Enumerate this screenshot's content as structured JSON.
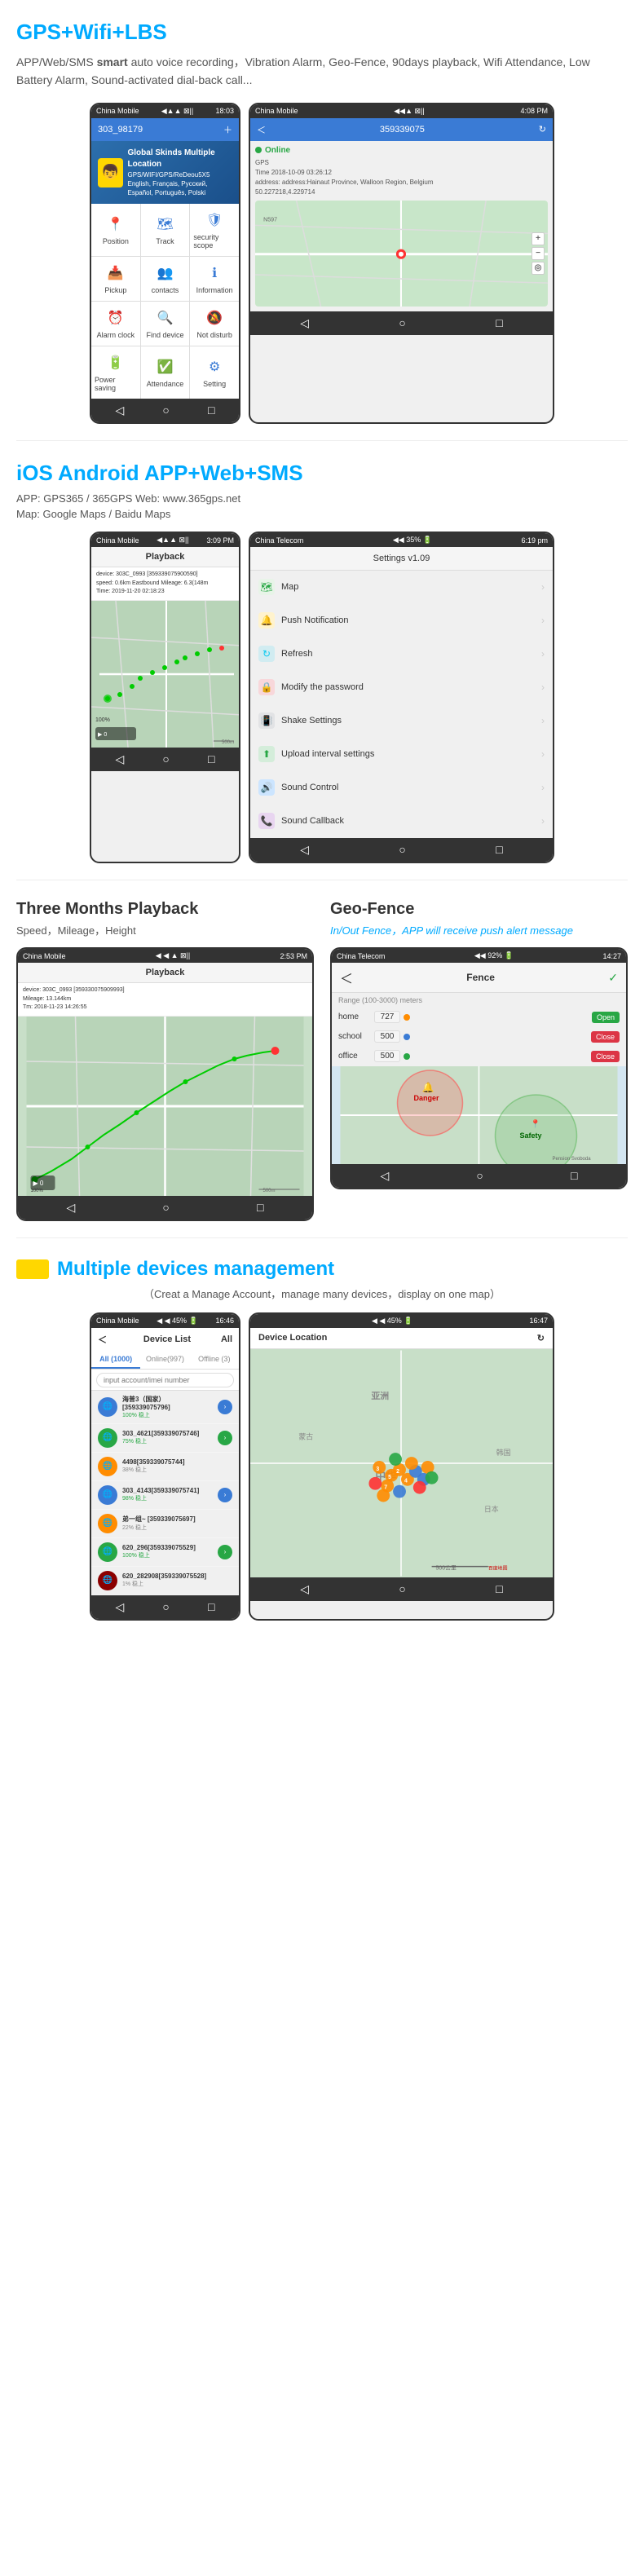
{
  "section1": {
    "title_plain": "GPS",
    "title_colored": "+Wifi+LBS",
    "description": "APP/Web/SMS smart auto voice recording，Vibration Alarm, Geo-Fence, 90days playback, Wifi Attendance, Low Battery Alarm, Sound-activated dial-back call...",
    "desc_bold": "smart",
    "left_phone": {
      "carrier": "China Mobile",
      "signal": "◀▲▲ Σ||",
      "time": "18:03",
      "account": "303_98179",
      "banner_title": "Global Skinds Multiple Location",
      "banner_sub": "GPS/WIFI/GPS/ReDeou5X5",
      "banner_langs": "English, Français, Pyccкий,",
      "banner_langs2": "Español, Português, Polski",
      "menu": [
        {
          "icon": "📍",
          "label": "Position",
          "color": "blue"
        },
        {
          "icon": "🗺",
          "label": "Track",
          "color": "blue"
        },
        {
          "icon": "🛡",
          "label": "security scope",
          "color": "blue"
        },
        {
          "icon": "📥",
          "label": "Pickup",
          "color": "orange"
        },
        {
          "icon": "👥",
          "label": "contacts",
          "color": "green"
        },
        {
          "icon": "ℹ",
          "label": "Information",
          "color": "blue"
        },
        {
          "icon": "⏰",
          "label": "Alarm clock",
          "color": "orange"
        },
        {
          "icon": "🔍",
          "label": "Find device",
          "color": "purple"
        },
        {
          "icon": "🔕",
          "label": "Not disturb",
          "color": "red"
        },
        {
          "icon": "🔋",
          "label": "Power saving",
          "color": "green"
        },
        {
          "icon": "✅",
          "label": "Attendance",
          "color": "blue"
        },
        {
          "icon": "⚙",
          "label": "Setting",
          "color": "blue"
        }
      ]
    },
    "right_phone": {
      "carrier": "China Mobile",
      "signal": "◀◀▲ Σ||",
      "time": "4:08 PM",
      "account": "359339075",
      "status": "Online",
      "gps_label": "GPS",
      "time_info": "Time 2018-10-09 03:26:12",
      "address_info": "address: address:Hainaut Province, Walloon Region, Belgium",
      "coords": "50.227218,4.229714"
    }
  },
  "section2": {
    "title_plain": "iOS Android APP",
    "title_colored": "+Web+SMS",
    "app_line": "APP:  GPS365 / 365GPS   Web:  www.365gps.net",
    "map_line": "Map:  Google Maps / Baidu Maps",
    "left_phone": {
      "carrier": "China Mobile",
      "signal": "◀▲▲ Σ||",
      "time": "3:09 PM",
      "title": "Playback",
      "info_line1": "device: 303C_0993 [359339075900590]",
      "info_line2": "speed: 0.6km Eastbound Mileage: 6.3(148m",
      "info_line3": "Time: 2019-11-20 02:18:23"
    },
    "right_phone": {
      "carrier": "China Telecom",
      "signal": "◀◀ 35% 🔋",
      "time": "6:19 pm",
      "title": "Settings v1.09",
      "items": [
        {
          "icon": "map",
          "label": "Map"
        },
        {
          "icon": "notif",
          "label": "Push Notification"
        },
        {
          "icon": "refresh",
          "label": "Refresh"
        },
        {
          "icon": "lock",
          "label": "Modify the password"
        },
        {
          "icon": "shake",
          "label": "Shake Settings"
        },
        {
          "icon": "upload",
          "label": "Upload interval settings"
        },
        {
          "icon": "sound",
          "label": "Sound Control"
        },
        {
          "icon": "callback",
          "label": "Sound Callback"
        }
      ]
    }
  },
  "section3": {
    "left": {
      "title": "Three Months Playback",
      "subtitle": "Speed，Mileage，Height",
      "phone": {
        "carrier": "China Mobile",
        "signal": "◀ ◀ ▲ Σ||",
        "time": "2:53 PM",
        "title": "Playback",
        "info_line1": "device: 303C_0993 [359330075909993]",
        "info_line2": "Mileage: 13.144km",
        "info_line3": "Tm: 2018-11-23 14:26:55"
      }
    },
    "right": {
      "title": "Geo-Fence",
      "subtitle": "In/Out Fence，APP will receive push alert message",
      "phone": {
        "carrier": "China Telecom",
        "signal": "◀◀ 92% 🔋",
        "time": "14:27",
        "title": "Fence",
        "range_label": "Range (100-3000) meters",
        "rows": [
          {
            "name": "home",
            "value": "727",
            "dot_color": "#ff8c00",
            "btn": "Open",
            "btn_class": "open"
          },
          {
            "name": "school",
            "value": "500",
            "dot_color": "#3a7bd5",
            "btn": "Close",
            "btn_class": "close"
          },
          {
            "name": "office",
            "value": "500",
            "dot_color": "#28a745",
            "btn": "Close",
            "btn_class": "close"
          }
        ],
        "danger_label": "Danger",
        "safety_label": "Safety"
      }
    }
  },
  "section4": {
    "title_plain": "Multiple devices management",
    "sub_text": "（Creat a Manage Account，manage many devices，display on one map）",
    "left_phone": {
      "carrier": "China Mobile",
      "signal": "◀ ◀ 45% 🔋",
      "time": "16:46",
      "title": "Device List",
      "right_label": "All",
      "tabs": [
        "All (1000)",
        "Online(997)",
        "Offline (3)"
      ],
      "active_tab": 0,
      "search_placeholder": "input account/imei number",
      "devices": [
        {
          "id": "海普3（国家）[359339075796]",
          "status": "100% 稳上",
          "has_btn": true,
          "btn_class": "blue",
          "avatar_class": ""
        },
        {
          "id": "303_4621[359339075746]",
          "status": "75% 稳上",
          "has_btn": true,
          "btn_class": "green",
          "avatar_class": "green"
        },
        {
          "id": "4498[359339075744]",
          "status": "38% 稳上",
          "has_btn": false,
          "btn_class": "",
          "avatar_class": "orange"
        },
        {
          "id": "303_4143[359339075741]",
          "status": "98% 稳上",
          "has_btn": true,
          "btn_class": "blue",
          "avatar_class": ""
        },
        {
          "id": "弟一组~ [359339075697]",
          "status": "22% 稳上",
          "has_btn": false,
          "btn_class": "",
          "avatar_class": "orange"
        },
        {
          "id": "620_296[359339075529]",
          "status": "100% 稳上",
          "has_btn": true,
          "btn_class": "green",
          "avatar_class": "green"
        },
        {
          "id": "620_282908[359339075528]",
          "status": "1% 稳上",
          "has_btn": false,
          "btn_class": "",
          "avatar_class": "red-dark"
        }
      ]
    },
    "right_phone": {
      "carrier": "",
      "signal": "◀ ◀ 45% 🔋",
      "time": "16:47",
      "title": "Device Location"
    }
  }
}
